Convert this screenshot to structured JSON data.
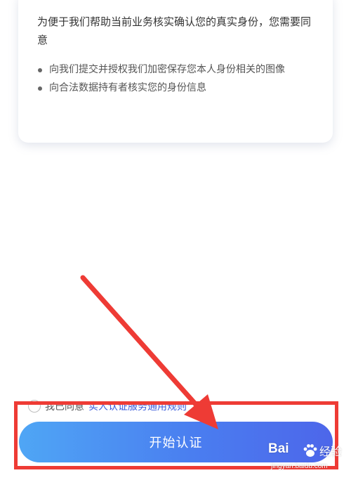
{
  "consent_card": {
    "intro": "为便于我们帮助当前业务核实确认您的真实身份，您需要同意",
    "items": [
      {
        "text": "向我们提交并授权我们加密保存您本人身份相关的图像"
      },
      {
        "text": "向合法数据持有者核实您的身份信息"
      }
    ]
  },
  "agreement": {
    "prefix": "我已同意",
    "link": "实人认证服务通用规则"
  },
  "start_button": {
    "label": "开始认证"
  },
  "annotation": {
    "color": "#ee3b35"
  },
  "watermark": {
    "brand": "Bai",
    "brand_cn": "经验",
    "url": "jingyan.baidu.com"
  },
  "colors": {
    "button_gradient_start": "#4fa6f5",
    "button_gradient_end": "#4d66ea",
    "link": "#3b5bdb"
  }
}
